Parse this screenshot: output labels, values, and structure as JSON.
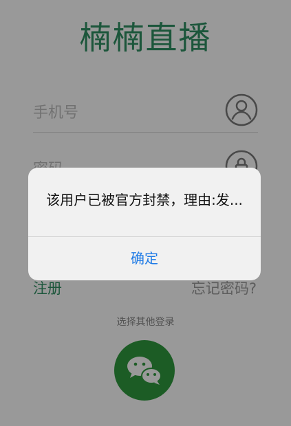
{
  "app": {
    "logo_text": "楠楠直播"
  },
  "login": {
    "phone_placeholder": "手机号",
    "password_placeholder": "密码",
    "register_label": "注册",
    "forgot_label": "忘记密码?",
    "other_login_label": "选择其他登录"
  },
  "dialog": {
    "message": "该用户已被官方封禁，理由:发...",
    "confirm_label": "确定"
  },
  "colors": {
    "brand_green": "#2f8f63",
    "wechat_green": "#2f9a3f",
    "dialog_button_blue": "#1f7be6"
  },
  "icons": [
    "user-icon",
    "lock-icon",
    "wechat-icon"
  ]
}
